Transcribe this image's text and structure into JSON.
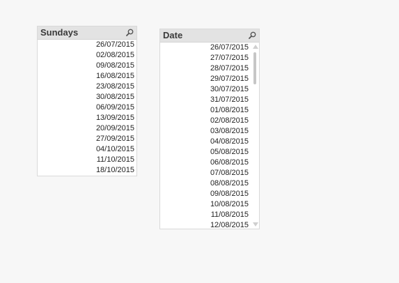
{
  "sundays_box": {
    "title": "Sundays",
    "search_icon": "magnifier-icon",
    "items": [
      "26/07/2015",
      "02/08/2015",
      "09/08/2015",
      "16/08/2015",
      "23/08/2015",
      "30/08/2015",
      "06/09/2015",
      "13/09/2015",
      "20/09/2015",
      "27/09/2015",
      "04/10/2015",
      "11/10/2015",
      "18/10/2015"
    ]
  },
  "date_box": {
    "title": "Date",
    "search_icon": "magnifier-icon",
    "items": [
      "26/07/2015",
      "27/07/2015",
      "28/07/2015",
      "29/07/2015",
      "30/07/2015",
      "31/07/2015",
      "01/08/2015",
      "02/08/2015",
      "03/08/2015",
      "04/08/2015",
      "05/08/2015",
      "06/08/2015",
      "07/08/2015",
      "08/08/2015",
      "09/08/2015",
      "10/08/2015",
      "11/08/2015",
      "12/08/2015"
    ]
  }
}
